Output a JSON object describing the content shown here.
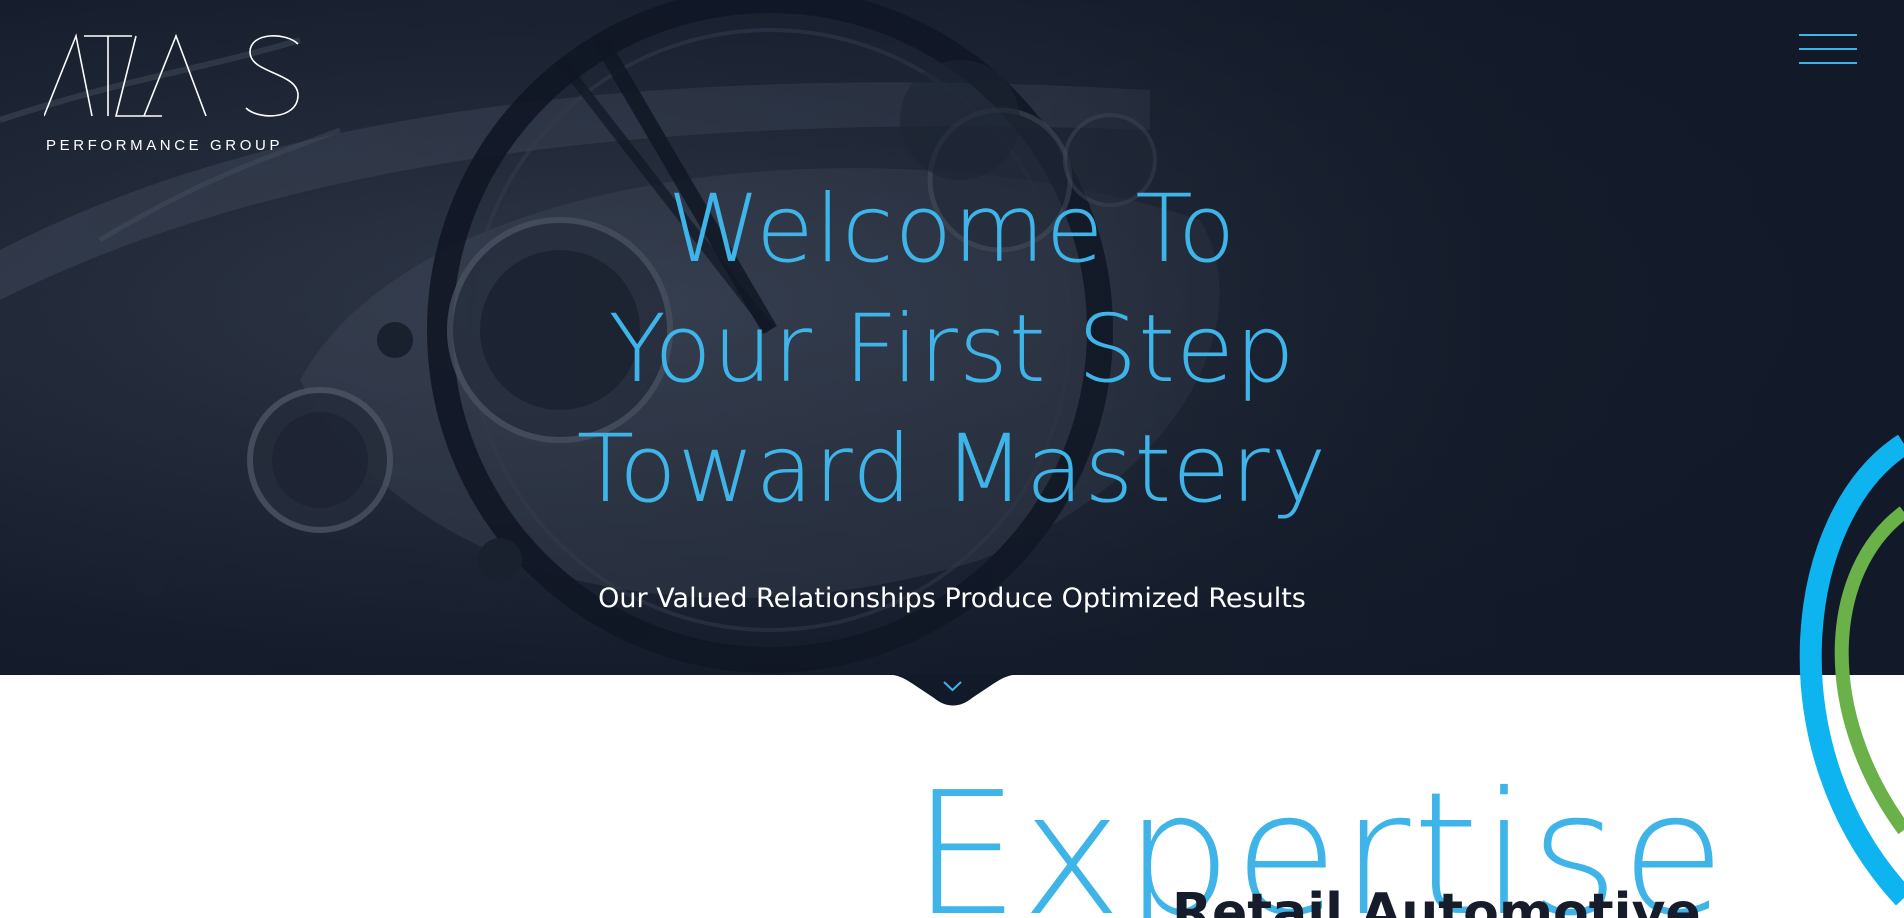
{
  "brand": {
    "logo_text": "ATLAS",
    "tagline": "PERFORMANCE GROUP"
  },
  "navigation": {
    "menu_icon": "hamburger-menu-icon"
  },
  "hero": {
    "title_lines": [
      "Welcome To",
      "Your First Step",
      "Toward Mastery"
    ],
    "subtitle": "Our Valued Relationships Produce Optimized Results",
    "scroll_icon": "chevron-down-icon",
    "background_image": "car-dashboard-steering-wheel-photo"
  },
  "section": {
    "heading": "Expertise",
    "subheading": "Retail Automotive"
  },
  "colors": {
    "accent_blue": "#3fb4e8",
    "accent_green": "#6ab14a",
    "navy": "#121a29",
    "white": "#ffffff"
  }
}
